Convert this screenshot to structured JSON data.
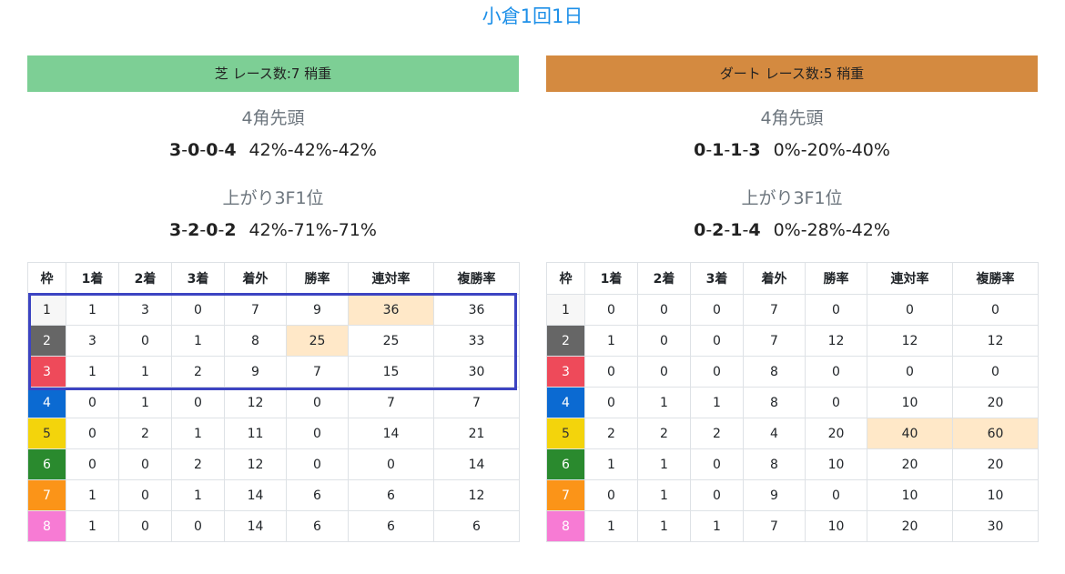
{
  "page_title": "小倉1回1日",
  "colors": {
    "title": "#1e90e8",
    "turf_header": "#7dcf95",
    "dirt_header": "#d48a40",
    "highlight_cell": "#ffe8c8",
    "selection_box": "#3c44c2"
  },
  "columns": [
    "枠",
    "1着",
    "2着",
    "3着",
    "着外",
    "勝率",
    "連対率",
    "複勝率"
  ],
  "turf": {
    "header": "芝 レース数:7 稍重",
    "corner_label": "4角先頭",
    "corner_counts": [
      "3",
      "0",
      "0",
      "4"
    ],
    "corner_rates": "42%-42%-42%",
    "last3f_label": "上がり3F1位",
    "last3f_counts": [
      "3",
      "2",
      "0",
      "2"
    ],
    "last3f_rates": "42%-71%-71%",
    "rows": [
      [
        "1",
        "1",
        "3",
        "0",
        "7",
        "9",
        "36",
        "36"
      ],
      [
        "2",
        "3",
        "0",
        "1",
        "8",
        "25",
        "25",
        "33"
      ],
      [
        "3",
        "1",
        "1",
        "2",
        "9",
        "7",
        "15",
        "30"
      ],
      [
        "4",
        "0",
        "1",
        "0",
        "12",
        "0",
        "7",
        "7"
      ],
      [
        "5",
        "0",
        "2",
        "1",
        "11",
        "0",
        "14",
        "21"
      ],
      [
        "6",
        "0",
        "0",
        "2",
        "12",
        "0",
        "0",
        "14"
      ],
      [
        "7",
        "1",
        "0",
        "1",
        "14",
        "6",
        "6",
        "12"
      ],
      [
        "8",
        "1",
        "0",
        "0",
        "14",
        "6",
        "6",
        "6"
      ]
    ],
    "highlighted_cells": [
      [
        0,
        6
      ],
      [
        1,
        5
      ]
    ]
  },
  "dirt": {
    "header": "ダート レース数:5 稍重",
    "corner_label": "4角先頭",
    "corner_counts": [
      "0",
      "1",
      "1",
      "3"
    ],
    "corner_rates": "0%-20%-40%",
    "last3f_label": "上がり3F1位",
    "last3f_counts": [
      "0",
      "2",
      "1",
      "4"
    ],
    "last3f_rates": "0%-28%-42%",
    "rows": [
      [
        "1",
        "0",
        "0",
        "0",
        "7",
        "0",
        "0",
        "0"
      ],
      [
        "2",
        "1",
        "0",
        "0",
        "7",
        "12",
        "12",
        "12"
      ],
      [
        "3",
        "0",
        "0",
        "0",
        "8",
        "0",
        "0",
        "0"
      ],
      [
        "4",
        "0",
        "1",
        "1",
        "8",
        "0",
        "10",
        "20"
      ],
      [
        "5",
        "2",
        "2",
        "2",
        "4",
        "20",
        "40",
        "60"
      ],
      [
        "6",
        "1",
        "1",
        "0",
        "8",
        "10",
        "20",
        "20"
      ],
      [
        "7",
        "0",
        "1",
        "0",
        "9",
        "0",
        "10",
        "10"
      ],
      [
        "8",
        "1",
        "1",
        "1",
        "7",
        "10",
        "20",
        "30"
      ]
    ],
    "highlighted_cells": [
      [
        4,
        6
      ],
      [
        4,
        7
      ]
    ]
  }
}
